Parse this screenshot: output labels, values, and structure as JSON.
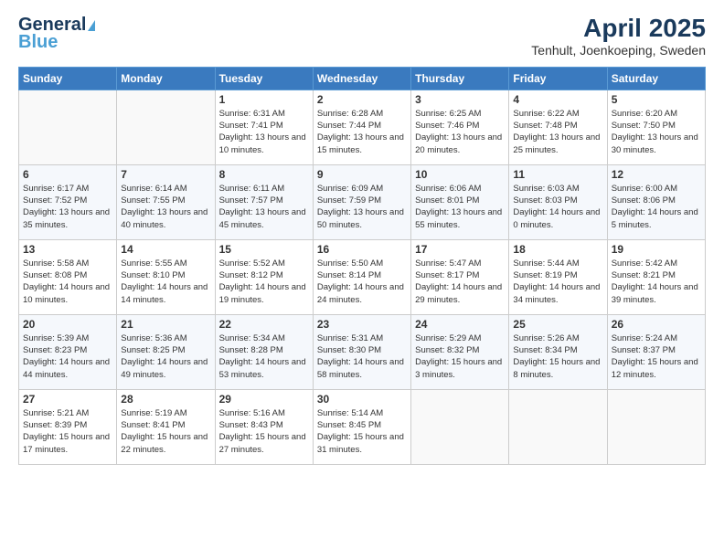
{
  "header": {
    "logo_general": "General",
    "logo_blue": "Blue",
    "month_title": "April 2025",
    "location": "Tenhult, Joenkoeping, Sweden"
  },
  "weekdays": [
    "Sunday",
    "Monday",
    "Tuesday",
    "Wednesday",
    "Thursday",
    "Friday",
    "Saturday"
  ],
  "weeks": [
    [
      {
        "day": "",
        "info": ""
      },
      {
        "day": "",
        "info": ""
      },
      {
        "day": "1",
        "info": "Sunrise: 6:31 AM\nSunset: 7:41 PM\nDaylight: 13 hours and 10 minutes."
      },
      {
        "day": "2",
        "info": "Sunrise: 6:28 AM\nSunset: 7:44 PM\nDaylight: 13 hours and 15 minutes."
      },
      {
        "day": "3",
        "info": "Sunrise: 6:25 AM\nSunset: 7:46 PM\nDaylight: 13 hours and 20 minutes."
      },
      {
        "day": "4",
        "info": "Sunrise: 6:22 AM\nSunset: 7:48 PM\nDaylight: 13 hours and 25 minutes."
      },
      {
        "day": "5",
        "info": "Sunrise: 6:20 AM\nSunset: 7:50 PM\nDaylight: 13 hours and 30 minutes."
      }
    ],
    [
      {
        "day": "6",
        "info": "Sunrise: 6:17 AM\nSunset: 7:52 PM\nDaylight: 13 hours and 35 minutes."
      },
      {
        "day": "7",
        "info": "Sunrise: 6:14 AM\nSunset: 7:55 PM\nDaylight: 13 hours and 40 minutes."
      },
      {
        "day": "8",
        "info": "Sunrise: 6:11 AM\nSunset: 7:57 PM\nDaylight: 13 hours and 45 minutes."
      },
      {
        "day": "9",
        "info": "Sunrise: 6:09 AM\nSunset: 7:59 PM\nDaylight: 13 hours and 50 minutes."
      },
      {
        "day": "10",
        "info": "Sunrise: 6:06 AM\nSunset: 8:01 PM\nDaylight: 13 hours and 55 minutes."
      },
      {
        "day": "11",
        "info": "Sunrise: 6:03 AM\nSunset: 8:03 PM\nDaylight: 14 hours and 0 minutes."
      },
      {
        "day": "12",
        "info": "Sunrise: 6:00 AM\nSunset: 8:06 PM\nDaylight: 14 hours and 5 minutes."
      }
    ],
    [
      {
        "day": "13",
        "info": "Sunrise: 5:58 AM\nSunset: 8:08 PM\nDaylight: 14 hours and 10 minutes."
      },
      {
        "day": "14",
        "info": "Sunrise: 5:55 AM\nSunset: 8:10 PM\nDaylight: 14 hours and 14 minutes."
      },
      {
        "day": "15",
        "info": "Sunrise: 5:52 AM\nSunset: 8:12 PM\nDaylight: 14 hours and 19 minutes."
      },
      {
        "day": "16",
        "info": "Sunrise: 5:50 AM\nSunset: 8:14 PM\nDaylight: 14 hours and 24 minutes."
      },
      {
        "day": "17",
        "info": "Sunrise: 5:47 AM\nSunset: 8:17 PM\nDaylight: 14 hours and 29 minutes."
      },
      {
        "day": "18",
        "info": "Sunrise: 5:44 AM\nSunset: 8:19 PM\nDaylight: 14 hours and 34 minutes."
      },
      {
        "day": "19",
        "info": "Sunrise: 5:42 AM\nSunset: 8:21 PM\nDaylight: 14 hours and 39 minutes."
      }
    ],
    [
      {
        "day": "20",
        "info": "Sunrise: 5:39 AM\nSunset: 8:23 PM\nDaylight: 14 hours and 44 minutes."
      },
      {
        "day": "21",
        "info": "Sunrise: 5:36 AM\nSunset: 8:25 PM\nDaylight: 14 hours and 49 minutes."
      },
      {
        "day": "22",
        "info": "Sunrise: 5:34 AM\nSunset: 8:28 PM\nDaylight: 14 hours and 53 minutes."
      },
      {
        "day": "23",
        "info": "Sunrise: 5:31 AM\nSunset: 8:30 PM\nDaylight: 14 hours and 58 minutes."
      },
      {
        "day": "24",
        "info": "Sunrise: 5:29 AM\nSunset: 8:32 PM\nDaylight: 15 hours and 3 minutes."
      },
      {
        "day": "25",
        "info": "Sunrise: 5:26 AM\nSunset: 8:34 PM\nDaylight: 15 hours and 8 minutes."
      },
      {
        "day": "26",
        "info": "Sunrise: 5:24 AM\nSunset: 8:37 PM\nDaylight: 15 hours and 12 minutes."
      }
    ],
    [
      {
        "day": "27",
        "info": "Sunrise: 5:21 AM\nSunset: 8:39 PM\nDaylight: 15 hours and 17 minutes."
      },
      {
        "day": "28",
        "info": "Sunrise: 5:19 AM\nSunset: 8:41 PM\nDaylight: 15 hours and 22 minutes."
      },
      {
        "day": "29",
        "info": "Sunrise: 5:16 AM\nSunset: 8:43 PM\nDaylight: 15 hours and 27 minutes."
      },
      {
        "day": "30",
        "info": "Sunrise: 5:14 AM\nSunset: 8:45 PM\nDaylight: 15 hours and 31 minutes."
      },
      {
        "day": "",
        "info": ""
      },
      {
        "day": "",
        "info": ""
      },
      {
        "day": "",
        "info": ""
      }
    ]
  ]
}
